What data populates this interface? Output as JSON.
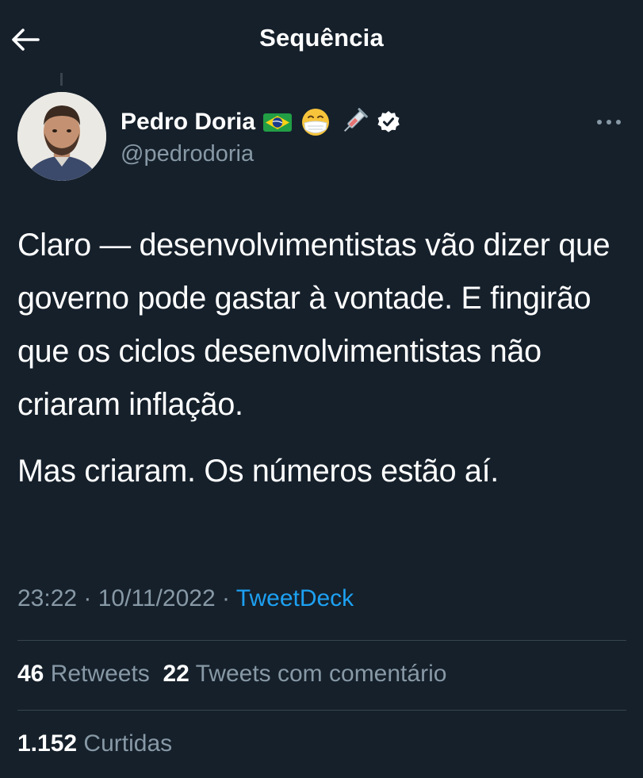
{
  "header": {
    "title": "Sequência",
    "back_icon": "arrow-left-icon"
  },
  "tweet": {
    "author": {
      "name": "Pedro Doria",
      "handle": "@pedrodoria",
      "name_emojis": [
        "brazil-flag-icon",
        "face-with-medical-mask-icon",
        "syringe-icon"
      ],
      "verified_icon": "verified-badge-icon"
    },
    "text": {
      "paragraph1": "Claro — desenvolvimentistas vão dizer que governo pode gastar à vontade. E fingirão que os ciclos desenvolvimentistas não criaram inflação.",
      "paragraph2": "Mas criaram. Os números estão aí."
    },
    "meta": {
      "time": "23:22",
      "sep1": " · ",
      "date": "10/11/2022",
      "sep2": " · ",
      "source": "TweetDeck"
    },
    "stats": {
      "retweets_count": "46",
      "retweets_label": "Retweets",
      "quotes_count": "22",
      "quotes_label": "Tweets com comentário",
      "likes_count": "1.152",
      "likes_label": "Curtidas"
    }
  },
  "colors": {
    "background": "#15202b",
    "text_primary": "#ffffff",
    "text_secondary": "#8899a6",
    "accent": "#1da1f2",
    "divider": "#38444d"
  }
}
